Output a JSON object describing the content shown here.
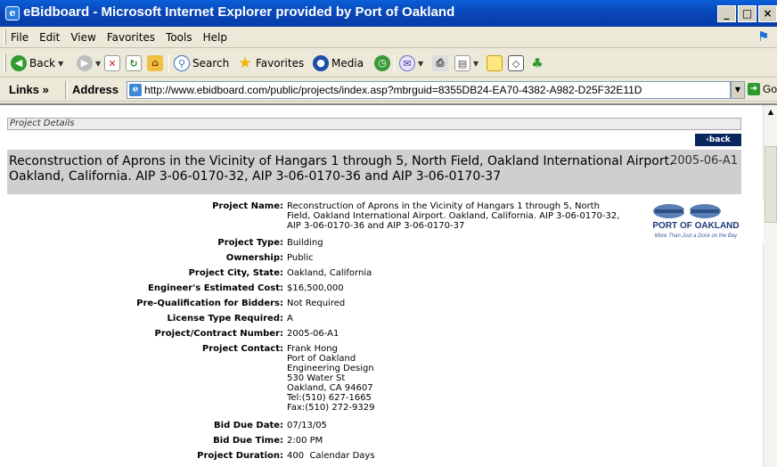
{
  "window": {
    "title": "eBidboard - Microsoft Internet Explorer provided by Port of Oakland"
  },
  "menu": [
    "File",
    "Edit",
    "View",
    "Favorites",
    "Tools",
    "Help"
  ],
  "toolbar": {
    "back": "Back",
    "search": "Search",
    "favorites": "Favorites",
    "media": "Media"
  },
  "addressbar": {
    "links_label": "Links",
    "address_label": "Address",
    "url": "http://www.ebidboard.com/public/projects/index.asp?mbrguid=8355DB24-EA70-4382-A982-D25F32E11D",
    "go_label": "Go"
  },
  "page": {
    "section_title": "Project Details",
    "back_label": "‹back",
    "project_title": "Reconstruction of Aprons in the Vicinity of Hangars 1 through 5, North Field, Oakland International Airport. Oakland, California. AIP 3-06-0170-32, AIP 3-06-0170-36 and AIP 3-06-0170-37",
    "project_number": "2005-06-A1",
    "logo": {
      "name": "PORT OF OAKLAND",
      "tagline": "More Than Just a Dock on the Bay"
    },
    "fields": [
      {
        "label": "Project Name:",
        "value": "Reconstruction of Aprons in the Vicinity of Hangars 1 through 5, North Field, Oakland International Airport. Oakland, California. AIP 3-06-0170-32, AIP 3-06-0170-36 and AIP 3-06-0170-37"
      },
      {
        "label": "Project Type:",
        "value": "Building"
      },
      {
        "label": "Ownership:",
        "value": "Public"
      },
      {
        "label": "Project City, State:",
        "value": "Oakland, California"
      },
      {
        "label": "Engineer's Estimated Cost:",
        "value": "$16,500,000"
      },
      {
        "label": "Pre-Qualification for Bidders:",
        "value": "Not Required"
      },
      {
        "label": "License Type Required:",
        "value": "A"
      },
      {
        "label": "Project/Contract Number:",
        "value": "2005-06-A1"
      },
      {
        "label": "Project Contact:",
        "value": "Frank Hong\nPort of Oakland\nEngineering Design\n530 Water St\nOakland, CA 94607\nTel:(510) 627-1665\nFax:(510) 272-9329"
      },
      {
        "label": "Bid Due Date:",
        "value": "07/13/05"
      },
      {
        "label": "Bid Due Time:",
        "value": "2:00 PM"
      },
      {
        "label": "Project Duration:",
        "value": "400  Calendar Days"
      }
    ]
  }
}
